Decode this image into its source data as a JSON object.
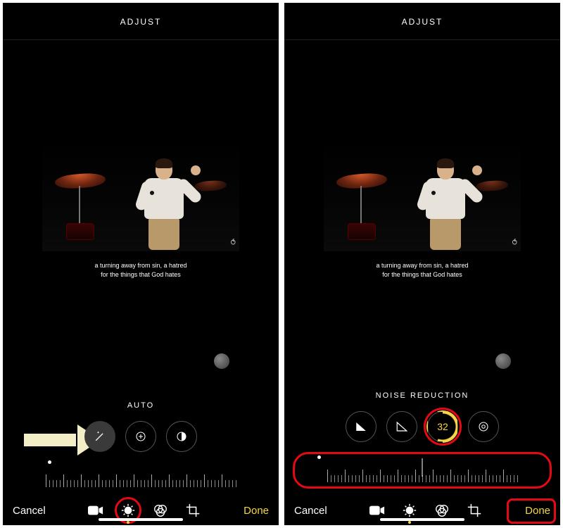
{
  "left": {
    "header": "ADJUST",
    "caption_line1": "a turning away from sin, a hatred",
    "caption_line2": "for the things that God hates",
    "tool_label": "AUTO",
    "loop_label": "⥀",
    "bottom": {
      "cancel": "Cancel",
      "done": "Done"
    },
    "icons": {
      "wand": "magic-wand-icon",
      "exposure": "exposure-icon",
      "contrast": "contrast-icon",
      "video": "video-icon",
      "adjust": "adjust-dial-icon",
      "filters": "filters-icon",
      "crop": "crop-icon"
    }
  },
  "right": {
    "header": "ADJUST",
    "caption_line1": "a turning away from sin, a hatred",
    "caption_line2": "for the things that God hates",
    "tool_label": "NOISE REDUCTION",
    "value": "32",
    "loop_label": "⥀",
    "bottom": {
      "cancel": "Cancel",
      "done": "Done"
    },
    "icons": {
      "sharpness": "sharpness-icon",
      "definition": "definition-icon",
      "noise": "noise-reduction-value",
      "vignette": "vignette-icon",
      "video": "video-icon",
      "adjust": "adjust-dial-icon",
      "filters": "filters-icon",
      "crop": "crop-icon"
    }
  },
  "colors": {
    "accent": "#f5d547",
    "highlight": "#e50914"
  }
}
